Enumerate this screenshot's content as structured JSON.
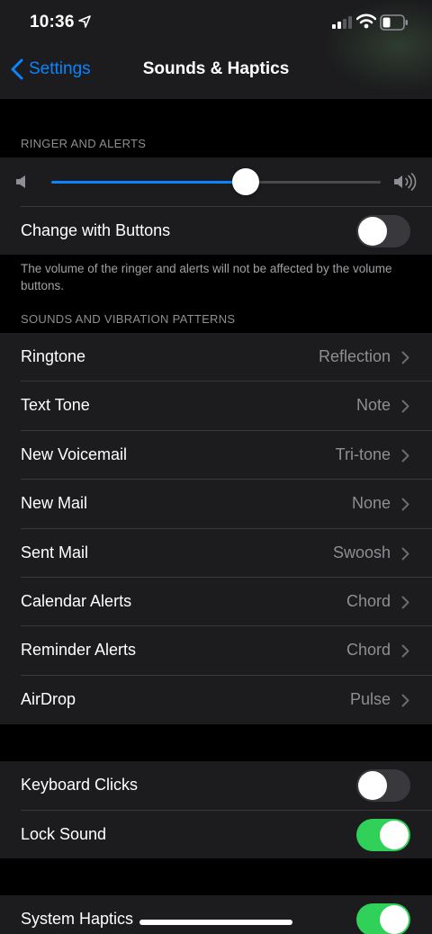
{
  "status_bar": {
    "time": "10:36"
  },
  "nav": {
    "back_label": "Settings",
    "title": "Sounds & Haptics"
  },
  "ringer": {
    "header": "RINGER AND ALERTS",
    "volume_level": 0.59,
    "change_with_buttons": {
      "label": "Change with Buttons",
      "on": false
    },
    "footer": "The volume of the ringer and alerts will not be affected by the volume buttons."
  },
  "patterns": {
    "header": "SOUNDS AND VIBRATION PATTERNS",
    "items": [
      {
        "label": "Ringtone",
        "value": "Reflection"
      },
      {
        "label": "Text Tone",
        "value": "Note"
      },
      {
        "label": "New Voicemail",
        "value": "Tri-tone"
      },
      {
        "label": "New Mail",
        "value": "None"
      },
      {
        "label": "Sent Mail",
        "value": "Swoosh"
      },
      {
        "label": "Calendar Alerts",
        "value": "Chord"
      },
      {
        "label": "Reminder Alerts",
        "value": "Chord"
      },
      {
        "label": "AirDrop",
        "value": "Pulse"
      }
    ]
  },
  "other": {
    "keyboard_clicks": {
      "label": "Keyboard Clicks",
      "on": false
    },
    "lock_sound": {
      "label": "Lock Sound",
      "on": true
    }
  },
  "haptics": {
    "system_haptics": {
      "label": "System Haptics",
      "on": true
    }
  },
  "colors": {
    "accent": "#0a84ff",
    "toggle_on": "#30d158",
    "cell_bg": "#1c1c1e",
    "secondary_text": "#8e8e93"
  },
  "icons": [
    "location-arrow-icon",
    "cellular-signal-icon",
    "wifi-icon",
    "battery-icon",
    "chevron-left-icon",
    "speaker-low-icon",
    "speaker-high-icon",
    "chevron-right-icon"
  ]
}
